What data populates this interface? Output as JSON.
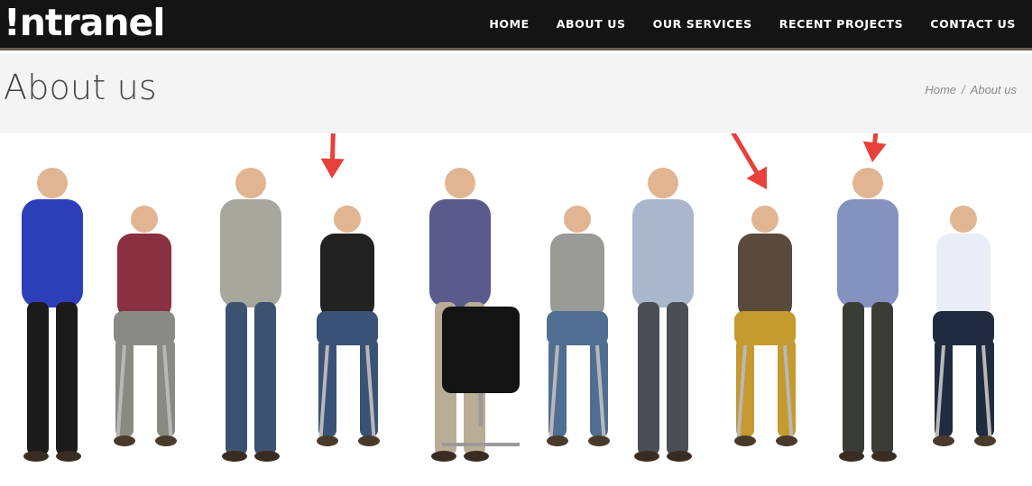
{
  "brand": {
    "logo_text": "!ntranel"
  },
  "nav": {
    "items": [
      {
        "label": "HOME"
      },
      {
        "label": "ABOUT US"
      },
      {
        "label": "OUR SERVICES"
      },
      {
        "label": "RECENT PROJECTS"
      },
      {
        "label": "CONTACT US"
      }
    ]
  },
  "page": {
    "title": "About us"
  },
  "breadcrumb": {
    "home": "Home",
    "separator": "/",
    "current": "About us"
  },
  "team_photo": {
    "people": [
      {
        "shirt": "#2d3fb8",
        "pants": "#1b1b1b",
        "seated": false
      },
      {
        "shirt": "#8a3040",
        "pants": "#8a8a84",
        "seated": true
      },
      {
        "shirt": "#a7a79d",
        "pants": "#3b5370",
        "seated": false
      },
      {
        "shirt": "#222222",
        "pants": "#3a5275",
        "seated": true
      },
      {
        "shirt": "#5a5a8c",
        "pants": "#b9ad97",
        "seated": false
      },
      {
        "shirt": "#9a9a96",
        "pants": "#506e92",
        "seated": true
      },
      {
        "shirt": "#aab6cc",
        "pants": "#4a4e55",
        "seated": false
      },
      {
        "shirt": "#5a4a3c",
        "pants": "#c59a2e",
        "seated": true
      },
      {
        "shirt": "#8392bf",
        "pants": "#3a3d35",
        "seated": false
      },
      {
        "shirt": "#e8edf7",
        "pants": "#1f2b3f",
        "seated": true
      }
    ],
    "arrow_color": "#e8403a",
    "arrows": [
      {
        "target_person": 4
      },
      {
        "target_person": 8
      },
      {
        "target_person": 9
      }
    ]
  }
}
